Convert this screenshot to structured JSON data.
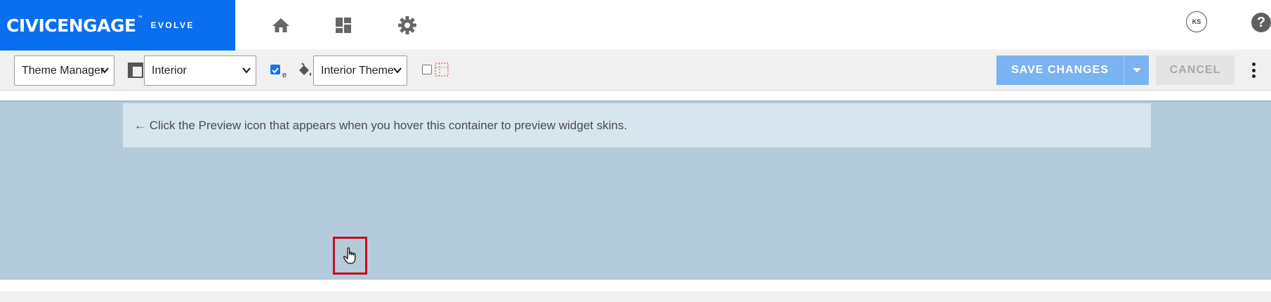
{
  "brand": {
    "name": "CIVICENGAGE",
    "trademark": "™",
    "product": "EVOLVE",
    "color": "#0a6ef0"
  },
  "nav": {
    "icons": [
      "home-icon",
      "dashboard-icon",
      "gear-icon"
    ],
    "user_initials": "KS",
    "help_label": "?"
  },
  "toolbar": {
    "manager_select": "Theme Manager",
    "layout_select": "Interior",
    "theme_select": "Interior Theme",
    "checkbox_sub_label": "e",
    "checkbox_1_checked": true,
    "checkbox_2_checked": false,
    "save_label": "SAVE CHANGES",
    "cancel_label": "CANCEL",
    "save_color": "#7ab3f1"
  },
  "content": {
    "notice_text": "← Click the Preview icon that appears when you hover this container to preview widget skins.",
    "background_color": "#b3cbdb",
    "highlight_color": "#c40f1d"
  }
}
